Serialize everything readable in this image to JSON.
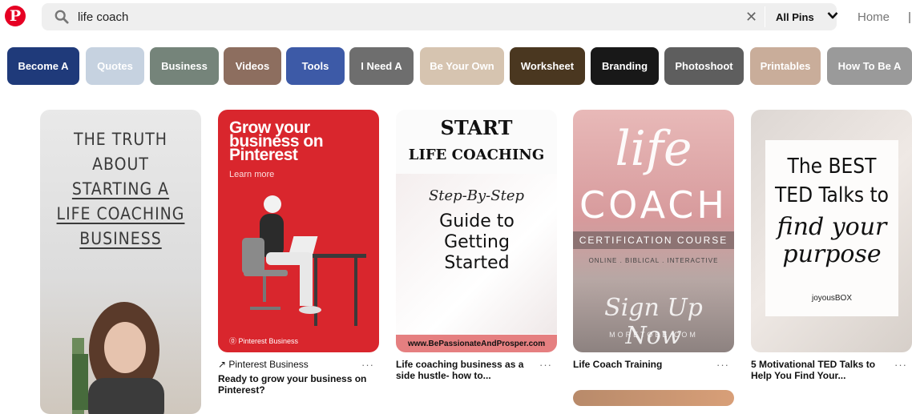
{
  "header": {
    "logo_letter": "P",
    "search_value": "life coach",
    "filter_label": "All Pins",
    "home_label": "Home"
  },
  "chips": [
    {
      "label": "Become A",
      "color": "#1f3a7a"
    },
    {
      "label": "Quotes",
      "color": "#c6d2e0"
    },
    {
      "label": "Business",
      "color": "#75847a"
    },
    {
      "label": "Videos",
      "color": "#8d6e5f"
    },
    {
      "label": "Tools",
      "color": "#3d5aa7"
    },
    {
      "label": "I Need A",
      "color": "#6e6e6e"
    },
    {
      "label": "Be Your Own",
      "color": "#d6c4b0"
    },
    {
      "label": "Worksheet",
      "color": "#4a3720"
    },
    {
      "label": "Branding",
      "color": "#181818"
    },
    {
      "label": "Photoshoot",
      "color": "#5e5e5e"
    },
    {
      "label": "Printables",
      "color": "#c9ad9a"
    },
    {
      "label": "How To Be A",
      "color": "#9a9a9a"
    }
  ],
  "pins": {
    "p1": {
      "lines": [
        "THE TRUTH",
        "ABOUT",
        "STARTING A",
        "LIFE COACHING",
        "BUSINESS"
      ]
    },
    "p2": {
      "headline": "Grow your business on Pinterest",
      "learn_more": "Learn more",
      "brand": "Pinterest Business",
      "source": "Pinterest Business",
      "title": "Ready to grow your business on Pinterest?"
    },
    "p3": {
      "start": "START",
      "life": "LIFE COACHING",
      "script": "Step-By-Step",
      "guide": "Guide to Getting Started",
      "url": "www.BePassionateAndProsper.com",
      "title": "Life coaching business as a side hustle- how to..."
    },
    "p4": {
      "life": "life",
      "coach": "COACH",
      "band": "CERTIFICATION COURSE",
      "online": "ONLINE . BIBLICAL . INTERACTIVE",
      "sign": "Sign Up Now",
      "site": "MORETOBE.COM",
      "title": "Life Coach Training"
    },
    "p5": {
      "line1": "The BEST",
      "line2": "TED Talks to",
      "line3": "find your purpose",
      "brand": "joyousBOX",
      "title": "5 Motivational TED Talks to Help You Find Your..."
    },
    "more_label": "···"
  }
}
